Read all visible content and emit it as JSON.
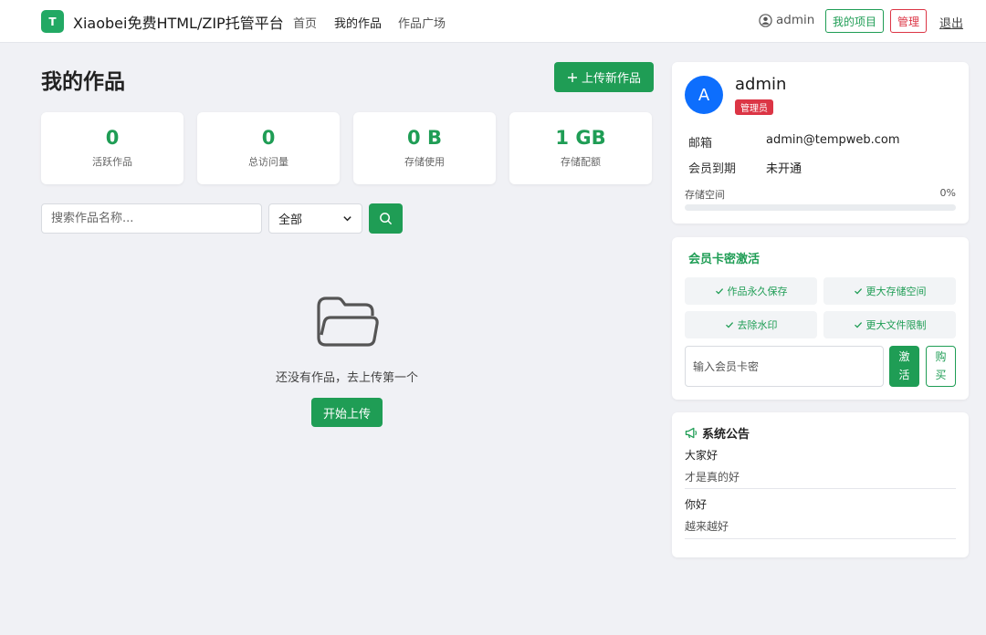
{
  "header": {
    "logo_letter": "T",
    "brand": "Xiaobei免费HTML/ZIP托管平台",
    "nav": [
      {
        "label": "首页",
        "active": false
      },
      {
        "label": "我的作品",
        "active": true
      },
      {
        "label": "作品广场",
        "active": false
      }
    ],
    "user": "admin",
    "my_projects": "我的项目",
    "admin": "管理",
    "logout": "退出"
  },
  "main": {
    "title": "我的作品",
    "upload_label": "上传新作品",
    "stats": [
      {
        "value": "0",
        "label": "活跃作品"
      },
      {
        "value": "0",
        "label": "总访问量"
      },
      {
        "value": "0 B",
        "label": "存储使用"
      },
      {
        "value": "1 GB",
        "label": "存储配额"
      }
    ],
    "search_placeholder": "搜索作品名称...",
    "filter_selected": "全部",
    "empty_text": "还没有作品，去上传第一个",
    "start_upload": "开始上传"
  },
  "profile": {
    "avatar_letter": "A",
    "username": "admin",
    "role": "管理员",
    "email_label": "邮箱",
    "email": "admin@tempweb.com",
    "expiry_label": "会员到期",
    "expiry": "未开通",
    "storage_label": "存储空间",
    "storage_percent_text": "0%",
    "storage_fraction": 0
  },
  "membership": {
    "title": "会员卡密激活",
    "features": [
      "作品永久保存",
      "更大存储空间",
      "去除水印",
      "更大文件限制"
    ],
    "input_placeholder": "输入会员卡密",
    "activate_label": "激活",
    "buy_label": "购买"
  },
  "notice": {
    "title": "系统公告",
    "items": [
      {
        "title": "大家好",
        "body": "才是真的好"
      },
      {
        "title": "你好",
        "body": "越来越好"
      }
    ]
  },
  "colors": {
    "accent": "#1f9d55",
    "danger": "#dc3545",
    "avatar": "#0d6efd"
  }
}
